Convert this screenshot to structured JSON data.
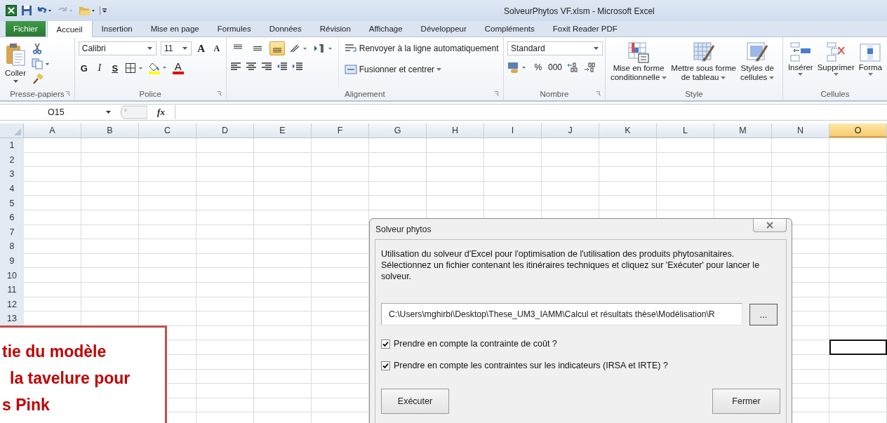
{
  "window": {
    "title": "SolveurPhytos VF.xlsm - Microsoft Excel"
  },
  "tabs": [
    {
      "label": "Fichier",
      "kind": "file",
      "selected": false
    },
    {
      "label": "Accueil",
      "kind": "tab",
      "selected": true
    },
    {
      "label": "Insertion",
      "kind": "tab",
      "selected": false
    },
    {
      "label": "Mise en page",
      "kind": "tab",
      "selected": false
    },
    {
      "label": "Formules",
      "kind": "tab",
      "selected": false
    },
    {
      "label": "Données",
      "kind": "tab",
      "selected": false
    },
    {
      "label": "Révision",
      "kind": "tab",
      "selected": false
    },
    {
      "label": "Affichage",
      "kind": "tab",
      "selected": false
    },
    {
      "label": "Développeur",
      "kind": "tab",
      "selected": false
    },
    {
      "label": "Compléments",
      "kind": "tab",
      "selected": false
    },
    {
      "label": "Foxit Reader PDF",
      "kind": "tab",
      "selected": false
    }
  ],
  "ribbon": {
    "clipboard": {
      "paste_label": "Coller",
      "group_label": "Presse-papiers"
    },
    "font": {
      "font_name": "Calibri",
      "font_size": "11",
      "grow_glyph": "A",
      "shrink_glyph": "A",
      "bold": "G",
      "italic": "I",
      "underline": "S",
      "color_glyph": "A",
      "group_label": "Police"
    },
    "alignment": {
      "vertical": [
        {
          "selected": false
        },
        {
          "selected": false
        },
        {
          "selected": true
        }
      ],
      "wrap_text": "Renvoyer à la ligne automatiquement",
      "merge": "Fusionner et centrer",
      "group_label": "Alignement"
    },
    "number": {
      "format": "Standard",
      "percent": "%",
      "thousands": "000",
      "group_label": "Nombre"
    },
    "styles": {
      "buttons": [
        {
          "lines": [
            "Mise en forme",
            "conditionnelle"
          ],
          "kind": "conditional"
        },
        {
          "lines": [
            "Mettre sous forme",
            "de tableau"
          ],
          "kind": "table"
        },
        {
          "lines": [
            "Styles de",
            "cellules"
          ],
          "kind": "cellstyle"
        }
      ],
      "group_label": "Style"
    },
    "cells": {
      "buttons": [
        {
          "label": "Insérer",
          "kind": "insert"
        },
        {
          "label": "Supprimer",
          "kind": "delete"
        },
        {
          "label": "Forma",
          "kind": "format"
        }
      ],
      "group_label": "Cellules"
    }
  },
  "formula_bar": {
    "name_box": "O15",
    "fx": "fx"
  },
  "sheet": {
    "columns": [
      {
        "label": "A",
        "selected": false
      },
      {
        "label": "B",
        "selected": false
      },
      {
        "label": "C",
        "selected": false
      },
      {
        "label": "D",
        "selected": false
      },
      {
        "label": "E",
        "selected": false
      },
      {
        "label": "F",
        "selected": false
      },
      {
        "label": "G",
        "selected": false
      },
      {
        "label": "H",
        "selected": false
      },
      {
        "label": "I",
        "selected": false
      },
      {
        "label": "J",
        "selected": false
      },
      {
        "label": "K",
        "selected": false
      },
      {
        "label": "L",
        "selected": false
      },
      {
        "label": "M",
        "selected": false
      },
      {
        "label": "N",
        "selected": false
      },
      {
        "label": "O",
        "selected": true
      }
    ],
    "rows": [
      {
        "header": "1",
        "selected": false
      },
      {
        "header": "2",
        "selected": false
      },
      {
        "header": "3",
        "selected": false
      },
      {
        "header": "4",
        "selected": false
      },
      {
        "header": "5",
        "selected": false
      },
      {
        "header": "6",
        "selected": false
      },
      {
        "header": "7",
        "selected": false
      },
      {
        "header": "8",
        "selected": false
      },
      {
        "header": "9",
        "selected": false
      },
      {
        "header": "10",
        "selected": false
      },
      {
        "header": "11",
        "selected": false
      },
      {
        "header": "12",
        "selected": false
      },
      {
        "header": "13",
        "selected": false
      },
      {
        "selected": false
      },
      {
        "selected": true
      },
      {
        "selected": false
      },
      {
        "selected": false
      },
      {
        "selected": false
      },
      {
        "selected": false
      },
      {
        "selected": false
      }
    ]
  },
  "dialog": {
    "title": "Solveur phytos",
    "description": "Utilisation du solveur d'Excel pour l'optimisation de l'utilisation des produits phytosanitaires.\nSélectionnez un fichier contenant les itinéraires techniques et cliquez sur 'Exécuter' pour lancer le solveur.",
    "path": "C:\\Users\\mghirbi\\Desktop\\These_UM3_IAMM\\Calcul et résultats thèse\\Modélisation\\R",
    "browse": "...",
    "options": [
      {
        "label": "Prendre en compte la contrainte de coût ?",
        "checked": true
      },
      {
        "label": "Prendre en compte les contraintes sur les indicateurs (IRSA et IRTE) ?",
        "checked": true
      }
    ],
    "buttons": [
      "Exécuter",
      "Fermer"
    ]
  },
  "callout": {
    "lines": [
      "tie du modèle",
      "la tavelure pour",
      "s Pink"
    ]
  }
}
